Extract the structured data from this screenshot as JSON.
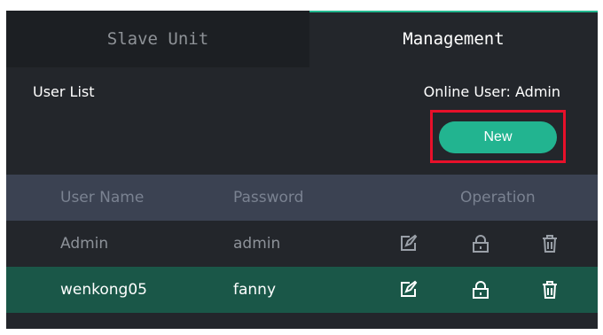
{
  "tabs": [
    {
      "label": "Slave Unit",
      "active": false
    },
    {
      "label": "Management",
      "active": true
    }
  ],
  "section_title": "User List",
  "online_user": "Online User: Admin",
  "new_button_label": "New",
  "table": {
    "headers": {
      "user_name": "User Name",
      "password": "Password",
      "operation": "Operation"
    },
    "rows": [
      {
        "user_name": "Admin",
        "password": "admin",
        "selected": false
      },
      {
        "user_name": "wenkong05",
        "password": "fanny",
        "selected": true
      }
    ]
  },
  "icons": [
    "edit-icon",
    "lock-icon",
    "delete-icon"
  ],
  "colors": {
    "panel_bg": "#23262b",
    "accent": "#22b490",
    "header_row": "#3b4252",
    "selected_row": "#1a5748",
    "highlight_border": "#e8102a"
  }
}
